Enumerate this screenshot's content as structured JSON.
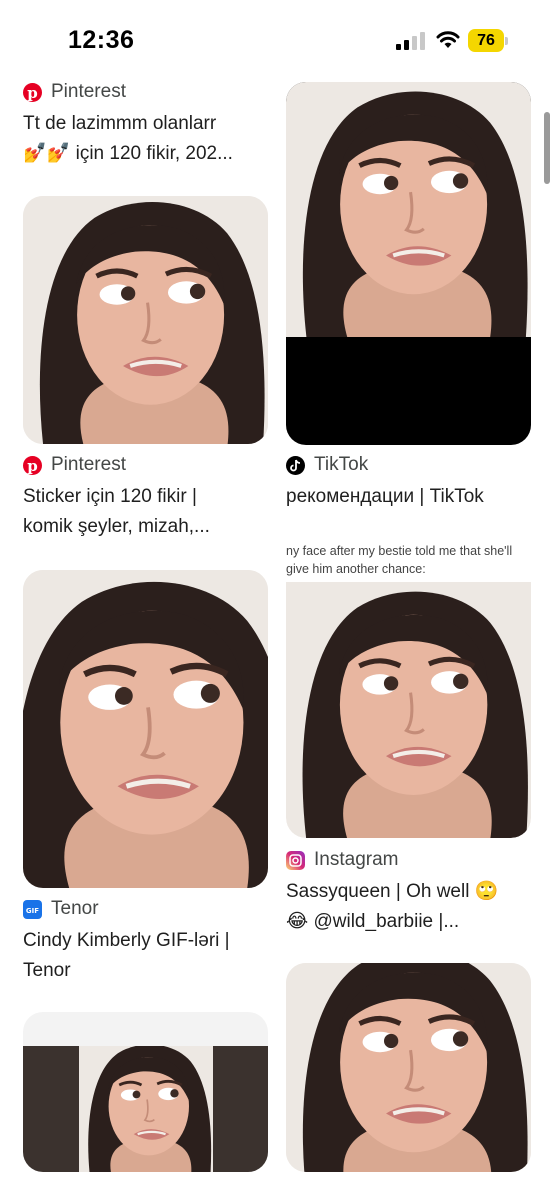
{
  "status_bar": {
    "time": "12:36",
    "battery": "76"
  },
  "meme_caption": "ny face after my bestie told me that she'll give him another chance:",
  "cards": [
    {
      "source": "Pinterest",
      "source_icon": "pinterest-icon",
      "line1": "Tt de lazimmm olanlarr",
      "line2": "💅💅 için 120 fikir, 202..."
    },
    {
      "source": "TikTok",
      "source_icon": "tiktok-icon",
      "line1": "рекомендации | TikTok",
      "line2": ""
    },
    {
      "source": "Pinterest",
      "source_icon": "pinterest-icon",
      "line1": "Sticker için 120 fikir |",
      "line2": "komik şeyler, mizah,..."
    },
    {
      "source": "Instagram",
      "source_icon": "instagram-icon",
      "line1": "Sassyqueen | Oh well 🙄",
      "line2": "😂 @wild_barbiie |..."
    },
    {
      "source": "Tenor",
      "source_icon": "gif-icon",
      "line1": "Cindy Kimberly GIF-ləri |",
      "line2": "Tenor"
    }
  ],
  "colors": {
    "pinterest": "#e60023",
    "tiktok": "#000000",
    "tenor": "#1a73e8",
    "accent_battery": "#f4d600"
  }
}
